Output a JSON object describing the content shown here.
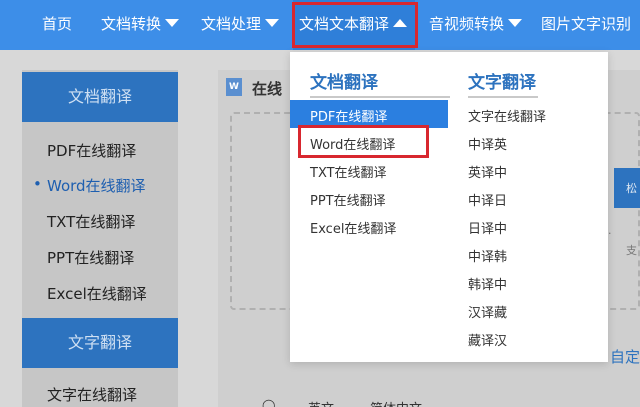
{
  "nav": {
    "items": [
      {
        "label": "首页",
        "caret": false
      },
      {
        "label": "文档转换",
        "caret": true
      },
      {
        "label": "文档处理",
        "caret": true
      },
      {
        "label": "文档文本翻译",
        "caret": true
      },
      {
        "label": "音视频转换",
        "caret": true
      },
      {
        "label": "图片文字识别",
        "caret": false
      }
    ]
  },
  "sidebar": {
    "doc_header": "文档翻译",
    "doc_items": [
      "PDF在线翻译",
      "Word在线翻译",
      "TXT在线翻译",
      "PPT在线翻译",
      "Excel在线翻译"
    ],
    "text_header": "文字翻译",
    "text_items": [
      "文字在线翻译"
    ]
  },
  "main": {
    "title_partial": "在线",
    "side_small_1": "松",
    "side_small_2": "支",
    "right_link_partial": "自定",
    "bottom_partial_1": "英文",
    "bottom_partial_2": "简体中文"
  },
  "dropdown": {
    "doc_col_title": "文档翻译",
    "doc_items": [
      "PDF在线翻译",
      "Word在线翻译",
      "TXT在线翻译",
      "PPT在线翻译",
      "Excel在线翻译"
    ],
    "text_col_title": "文字翻译",
    "text_items": [
      "文字在线翻译",
      "中译英",
      "英译中",
      "中译日",
      "日译中",
      "中译韩",
      "韩译中",
      "汉译藏",
      "藏译汉"
    ]
  },
  "colors": {
    "nav_bg": "#3d8ee8",
    "accent": "#2d73bf",
    "highlight": "#2b7fe0",
    "annotation_red": "#d8272f"
  }
}
